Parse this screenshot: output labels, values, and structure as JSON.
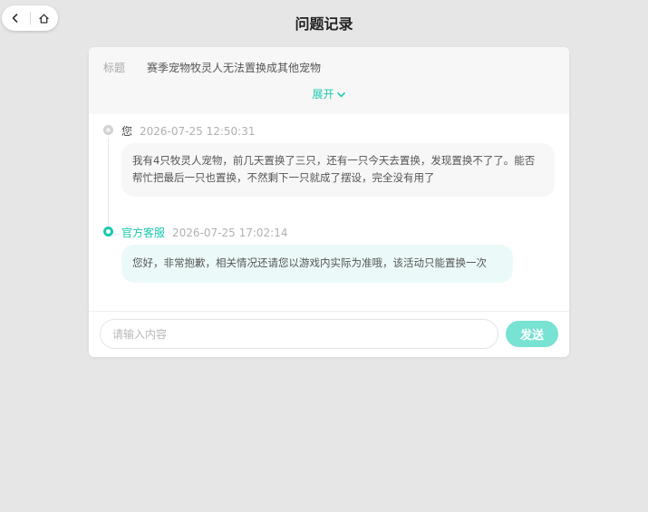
{
  "page": {
    "title": "问题记录"
  },
  "nav": {
    "back_icon": "chevron-left-icon",
    "home_icon": "home-icon"
  },
  "ticket": {
    "title_label": "标题",
    "title_value": "赛季宠物牧灵人无法置换成其他宠物",
    "expand_label": "展开"
  },
  "messages": [
    {
      "sender": "您",
      "time": "2026-07-25 12:50:31",
      "text": "我有4只牧灵人宠物，前几天置换了三只，还有一只今天去置换，发现置换不了了。能否帮忙把最后一只也置换，不然剩下一只就成了摆设，完全没有用了"
    },
    {
      "sender": "官方客服",
      "time": "2026-07-25 17:02:14",
      "text": "您好，非常抱歉，相关情况还请您以游戏内实际为准哦，该活动只能置换一次"
    }
  ],
  "composer": {
    "placeholder": "请输入内容",
    "value": "",
    "send_label": "发送"
  },
  "colors": {
    "accent": "#19c8b0",
    "send_button": "#78e2d3",
    "background": "#e6e6e6"
  }
}
